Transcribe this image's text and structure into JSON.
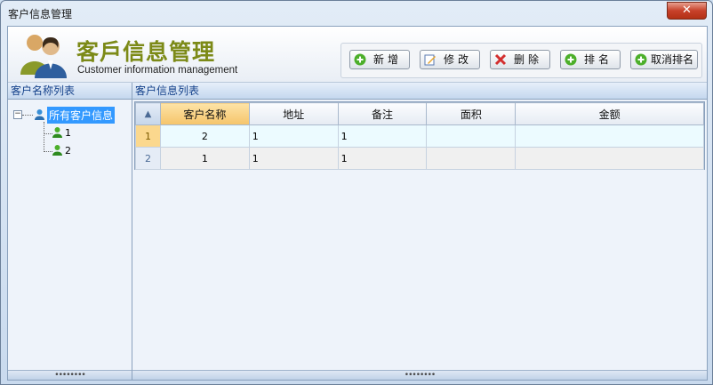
{
  "window": {
    "title": "客户信息管理",
    "close_label": "✕"
  },
  "header": {
    "title": "客戶信息管理",
    "subtitle": "Customer information management"
  },
  "toolbar": {
    "add_label": "新增",
    "edit_label": "修改",
    "delete_label": "删除",
    "rank_label": "排名",
    "cancel_rank_label": "取消排名"
  },
  "left_panel": {
    "title": "客户名称列表",
    "tree": {
      "root_label": "所有客户信息",
      "children": [
        {
          "label": "1"
        },
        {
          "label": "2"
        }
      ]
    }
  },
  "right_panel": {
    "title": "客户信息列表",
    "table": {
      "columns": [
        "客户名称",
        "地址",
        "备注",
        "面积",
        "金额"
      ],
      "rows": [
        {
          "num": "1",
          "name": "2",
          "address": "1",
          "note": "1",
          "area": "",
          "amount": ""
        },
        {
          "num": "2",
          "name": "1",
          "address": "1",
          "note": "1",
          "area": "",
          "amount": ""
        }
      ]
    }
  },
  "colors": {
    "selected_header": "#f5c46a",
    "tree_selection": "#3399ff",
    "title_accent": "#7c8a17"
  }
}
